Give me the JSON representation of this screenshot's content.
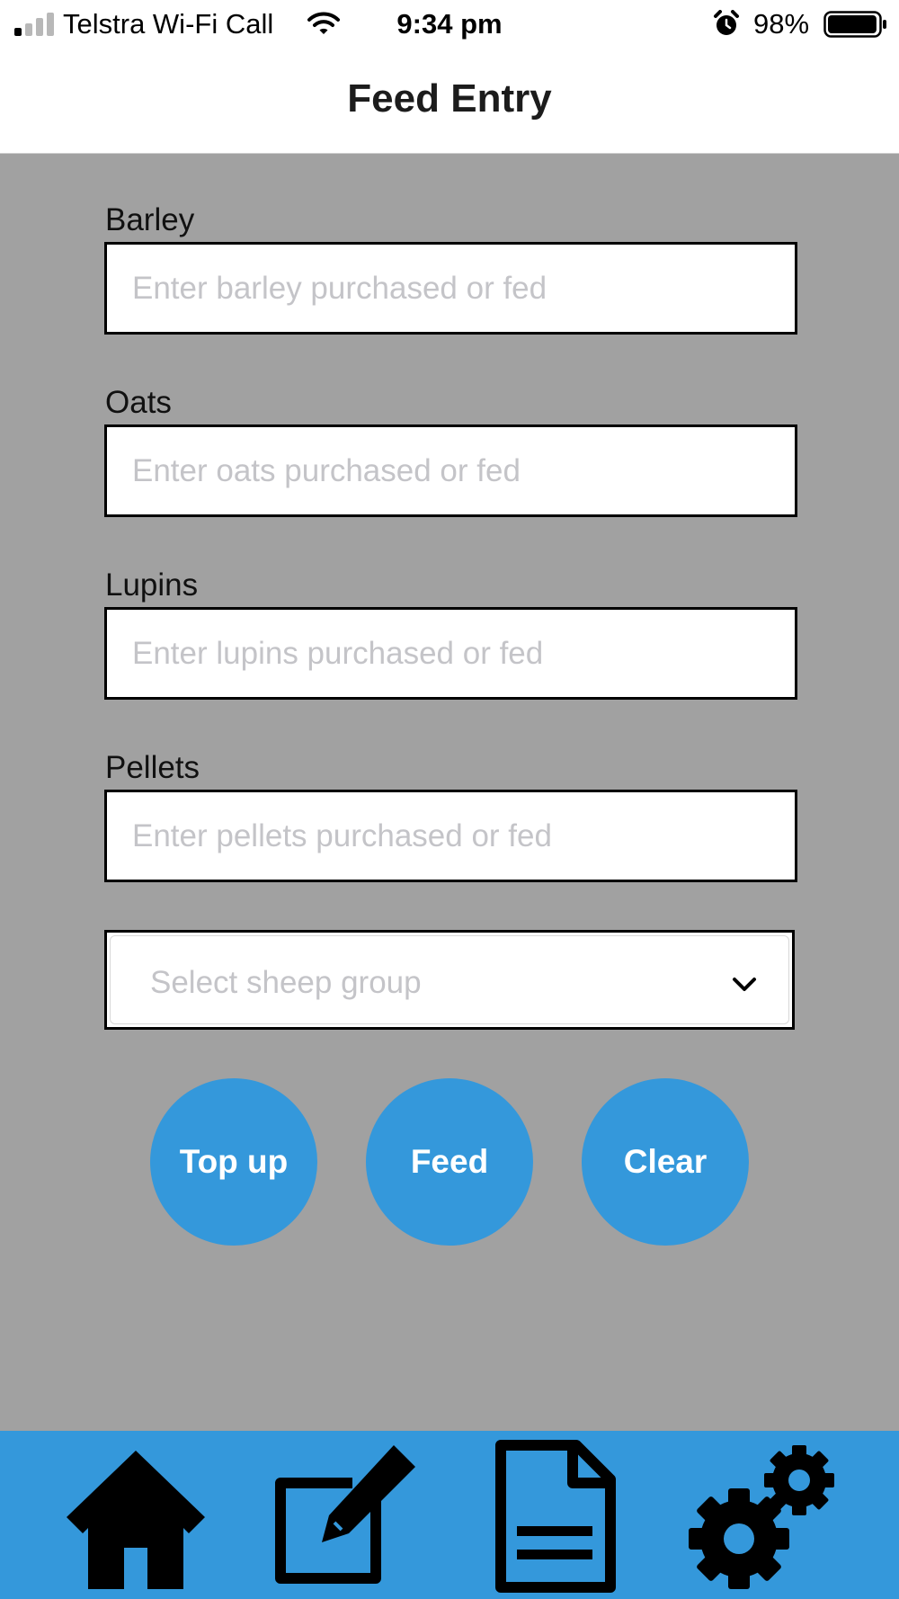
{
  "status_bar": {
    "carrier": "Telstra Wi-Fi Call",
    "time": "9:34 pm",
    "battery_percent": "98%",
    "signal_bars_active": 1,
    "signal_bars_total": 4,
    "battery_level": 0.98,
    "icons": [
      "signal-icon",
      "wifi-icon",
      "alarm-icon",
      "battery-icon"
    ]
  },
  "header": {
    "title": "Feed Entry"
  },
  "form": {
    "fields": [
      {
        "label": "Barley",
        "placeholder": "Enter barley purchased or fed",
        "value": ""
      },
      {
        "label": "Oats",
        "placeholder": "Enter oats purchased or fed",
        "value": ""
      },
      {
        "label": "Lupins",
        "placeholder": "Enter lupins purchased or fed",
        "value": ""
      },
      {
        "label": "Pellets",
        "placeholder": "Enter pellets purchased or fed",
        "value": ""
      }
    ],
    "sheep_group": {
      "placeholder": "Select sheep group",
      "icon": "chevron-down-icon"
    }
  },
  "buttons": {
    "top_up": "Top up",
    "feed": "Feed",
    "clear": "Clear"
  },
  "tab_bar": {
    "tabs": [
      {
        "icon": "home-icon"
      },
      {
        "icon": "edit-icon"
      },
      {
        "icon": "document-icon"
      },
      {
        "icon": "settings-icon"
      }
    ]
  },
  "colors": {
    "accent": "#3498db",
    "background": "#a1a1a1",
    "header_background": "#ffffff",
    "input_border": "#000000",
    "placeholder": "#c4c4c8"
  }
}
